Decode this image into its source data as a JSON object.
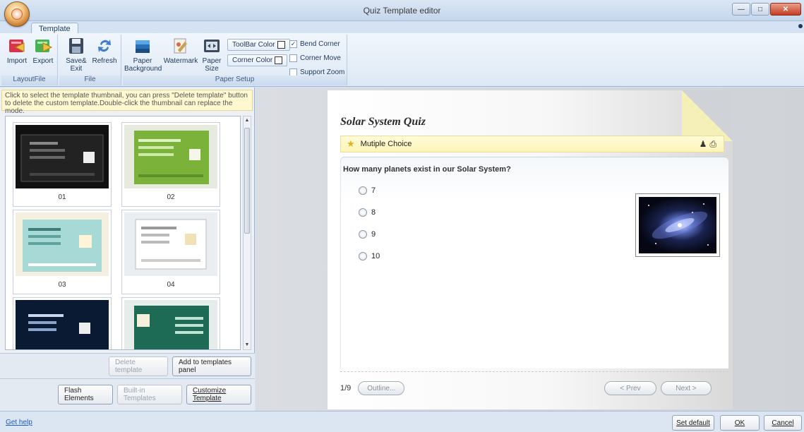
{
  "window": {
    "title": "Quiz Template editor"
  },
  "tabs": [
    {
      "label": "Template"
    }
  ],
  "ribbon": {
    "groups": [
      {
        "label": "LayoutFile",
        "buttons": [
          {
            "label": "Import",
            "icon": "import-icon"
          },
          {
            "label": "Export",
            "icon": "export-icon"
          }
        ]
      },
      {
        "label": "File",
        "buttons": [
          {
            "label": "Save& Exit",
            "icon": "save-icon"
          },
          {
            "label": "Refresh",
            "icon": "refresh-icon"
          }
        ]
      },
      {
        "label": "Paper Setup",
        "buttons": [
          {
            "label": "Paper Background",
            "icon": "paper-background-icon"
          },
          {
            "label": "Watermark",
            "icon": "watermark-icon"
          },
          {
            "label": "Paper Size",
            "icon": "paper-size-icon"
          }
        ]
      }
    ],
    "toolbar_color_label": "ToolBar Color",
    "corner_color_label": "Corner Color",
    "checkboxes": [
      {
        "label": "Bend Corner",
        "checked": true
      },
      {
        "label": "Corner Move",
        "checked": false
      },
      {
        "label": "Support Zoom",
        "checked": false
      }
    ]
  },
  "left_panel": {
    "hint": "Click to select the template thumbnail, you can press \"Delete template\" button to delete  the custom template.Double-click the thumbnail can replace the mode.",
    "thumbnails": [
      {
        "caption": "01",
        "theme": "#1a1a1a"
      },
      {
        "caption": "02",
        "theme": "#7ab23a"
      },
      {
        "caption": "03",
        "theme": "#9fd7da"
      },
      {
        "caption": "04",
        "theme": "#eef1f4"
      },
      {
        "caption": "",
        "theme": "#0b1a33"
      },
      {
        "caption": "",
        "theme": "#1d6b55"
      }
    ],
    "delete_button": "Delete template",
    "add_button": "Add to templates panel",
    "flash_elements_button": "Flash Elements",
    "builtin_templates_button": "Built-in Templates",
    "customize_template_button": "Customize Template"
  },
  "preview": {
    "quiz_title": "Solar System Quiz",
    "question_type": "Mutiple Choice",
    "question": "How many planets exist in our Solar System?",
    "options": [
      "7",
      "8",
      "9",
      "10"
    ],
    "page_indicator": "1/9",
    "outline_button": "Outline...",
    "prev_button": "< Prev",
    "next_button": "Next >"
  },
  "statusbar": {
    "help_link": "Get help",
    "set_default_button": "Set default",
    "ok_button": "OK",
    "cancel_button": "Cancel"
  }
}
